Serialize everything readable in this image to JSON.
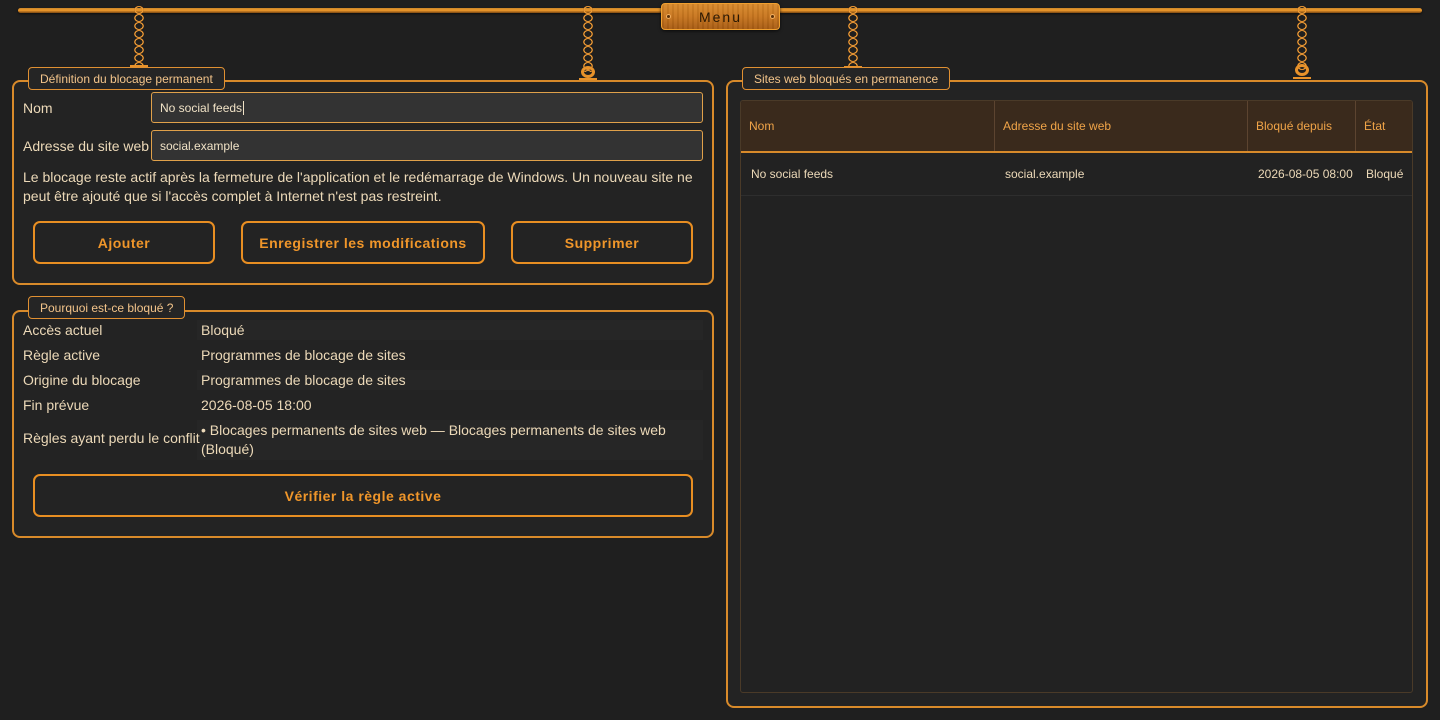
{
  "menu": {
    "label": "Menu"
  },
  "definition": {
    "title": "Définition du blocage permanent",
    "name_label": "Nom",
    "name_value": "No social feeds",
    "address_label": "Adresse du site web",
    "address_value": "social.example",
    "description": "Le blocage reste actif après la fermeture de l'application et le redémarrage de Windows. Un nouveau site ne peut être ajouté que si l'accès complet à Internet n'est pas restreint.",
    "add_label": "Ajouter",
    "save_label": "Enregistrer les modifications",
    "delete_label": "Supprimer"
  },
  "why": {
    "title": "Pourquoi est-ce bloqué ?",
    "rows": [
      {
        "label": "Accès actuel",
        "value": "Bloqué"
      },
      {
        "label": "Règle active",
        "value": "Programmes de blocage de sites"
      },
      {
        "label": "Origine du blocage",
        "value": "Programmes de blocage de sites"
      },
      {
        "label": "Fin prévue",
        "value": "2026-08-05 18:00"
      },
      {
        "label": "Règles ayant perdu le conflit",
        "value": "• Blocages permanents de sites web — Blocages permanents de sites web (Bloqué)"
      }
    ],
    "verify_label": "Vérifier la règle active"
  },
  "sites": {
    "title": "Sites web bloqués en permanence",
    "columns": [
      "Nom",
      "Adresse du site web",
      "Bloqué depuis",
      "État"
    ],
    "rows": [
      [
        "No social feeds",
        "social.example",
        "2026-08-05 08:00",
        "Bloqué"
      ]
    ]
  },
  "colors": {
    "accent": "#e88e22",
    "background": "#1f1f1f",
    "text": "#ecd9b8"
  }
}
